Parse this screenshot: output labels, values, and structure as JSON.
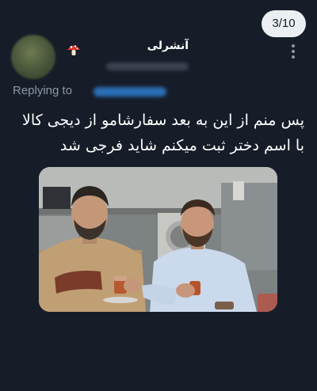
{
  "viewer": {
    "counter": "3/10"
  },
  "tweet": {
    "display_name": "آنشرلی",
    "name_icon": "mushroom-icon",
    "replying_to_label": "Replying to",
    "text": "پس منم از این به بعد سفارشامو از دیجی کالا با اسم دختر ثبت میکنم شاید فرجی شد",
    "avatar_icon": "blurred-avatar",
    "menu_icon": "more-vertical-icon",
    "media_icon": "photo-two-men-drinking-tea"
  },
  "colors": {
    "background": "#161d29",
    "counter_bg": "#eceff2",
    "muted_text": "#8b98a5",
    "link": "#1d9bf0"
  }
}
